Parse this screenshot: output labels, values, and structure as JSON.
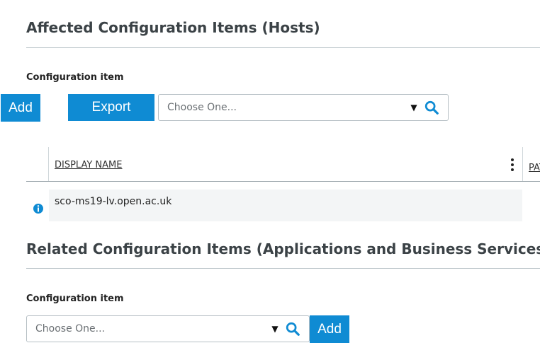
{
  "affected": {
    "title": "Affected Configuration Items (Hosts)",
    "field_label": "Configuration item",
    "add_label": "Add",
    "export_label": "Export",
    "combo_placeholder": "Choose One...",
    "table": {
      "columns": [
        "DISPLAY NAME",
        "PAT"
      ],
      "rows": [
        {
          "display_name": "sco-ms19-lv.open.ac.uk"
        }
      ]
    }
  },
  "related": {
    "title": "Related Configuration Items (Applications and Business Services)",
    "field_label": "Configuration item",
    "combo_placeholder": "Choose One...",
    "add_label": "Add"
  },
  "icons": {
    "caret": "caret-down-icon",
    "search": "search-icon",
    "kebab": "kebab-menu-icon",
    "info": "info-icon"
  },
  "colors": {
    "accent": "#0f8bd3",
    "divider": "#b9c3c8",
    "row_bg": "#f3f5f6"
  }
}
